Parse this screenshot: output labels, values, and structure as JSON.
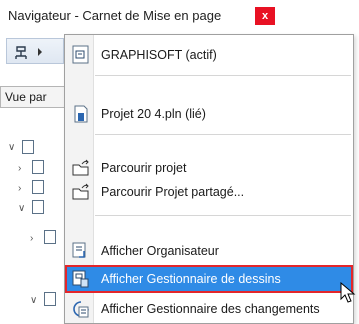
{
  "window": {
    "title": "Navigateur - Carnet de Mise en page",
    "close_glyph": "x"
  },
  "navigator": {
    "tab_label": "Vue par"
  },
  "menu": {
    "items": [
      {
        "label": "GRAPHISOFT (actif)",
        "icon": "teamwork-icon"
      },
      {
        "label": "Projet 20 4.pln (lié)",
        "icon": "project-file-icon"
      },
      {
        "label": "Parcourir projet",
        "icon": "browse-folder-icon"
      },
      {
        "label": "Parcourir Projet partagé...",
        "icon": "browse-shared-icon"
      },
      {
        "label": "Afficher Organisateur",
        "icon": "organizer-icon"
      },
      {
        "label": "Afficher Gestionnaire de dessins",
        "icon": "drawing-manager-icon",
        "highlighted": true
      },
      {
        "label": "Afficher Gestionnaire des changements",
        "icon": "change-manager-icon"
      }
    ]
  },
  "colors": {
    "highlight": "#2f8be6",
    "annotation_box": "#e3262b",
    "close_button": "#e81123"
  }
}
